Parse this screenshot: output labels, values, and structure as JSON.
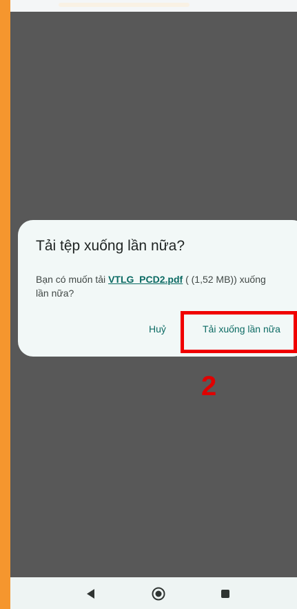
{
  "dialog": {
    "title": "Tải tệp xuống lần nữa?",
    "body_prefix": "Bạn có muốn tải ",
    "file_name": "VTLG_PCD2.pdf",
    "body_suffix": " ( (1,52 MB)) xuống lần nữa?",
    "cancel_label": "Huỷ",
    "retry_label": "Tải xuống lần nữa"
  },
  "annotation": {
    "step": "2",
    "color": "#f00000"
  },
  "colors": {
    "frame_border": "#f5962e",
    "scrim": "#585858",
    "dialog_bg": "#f2f8f7",
    "accent": "#0b6a63"
  },
  "nav": {
    "icons": [
      "back-icon",
      "home-icon",
      "recents-icon"
    ]
  }
}
